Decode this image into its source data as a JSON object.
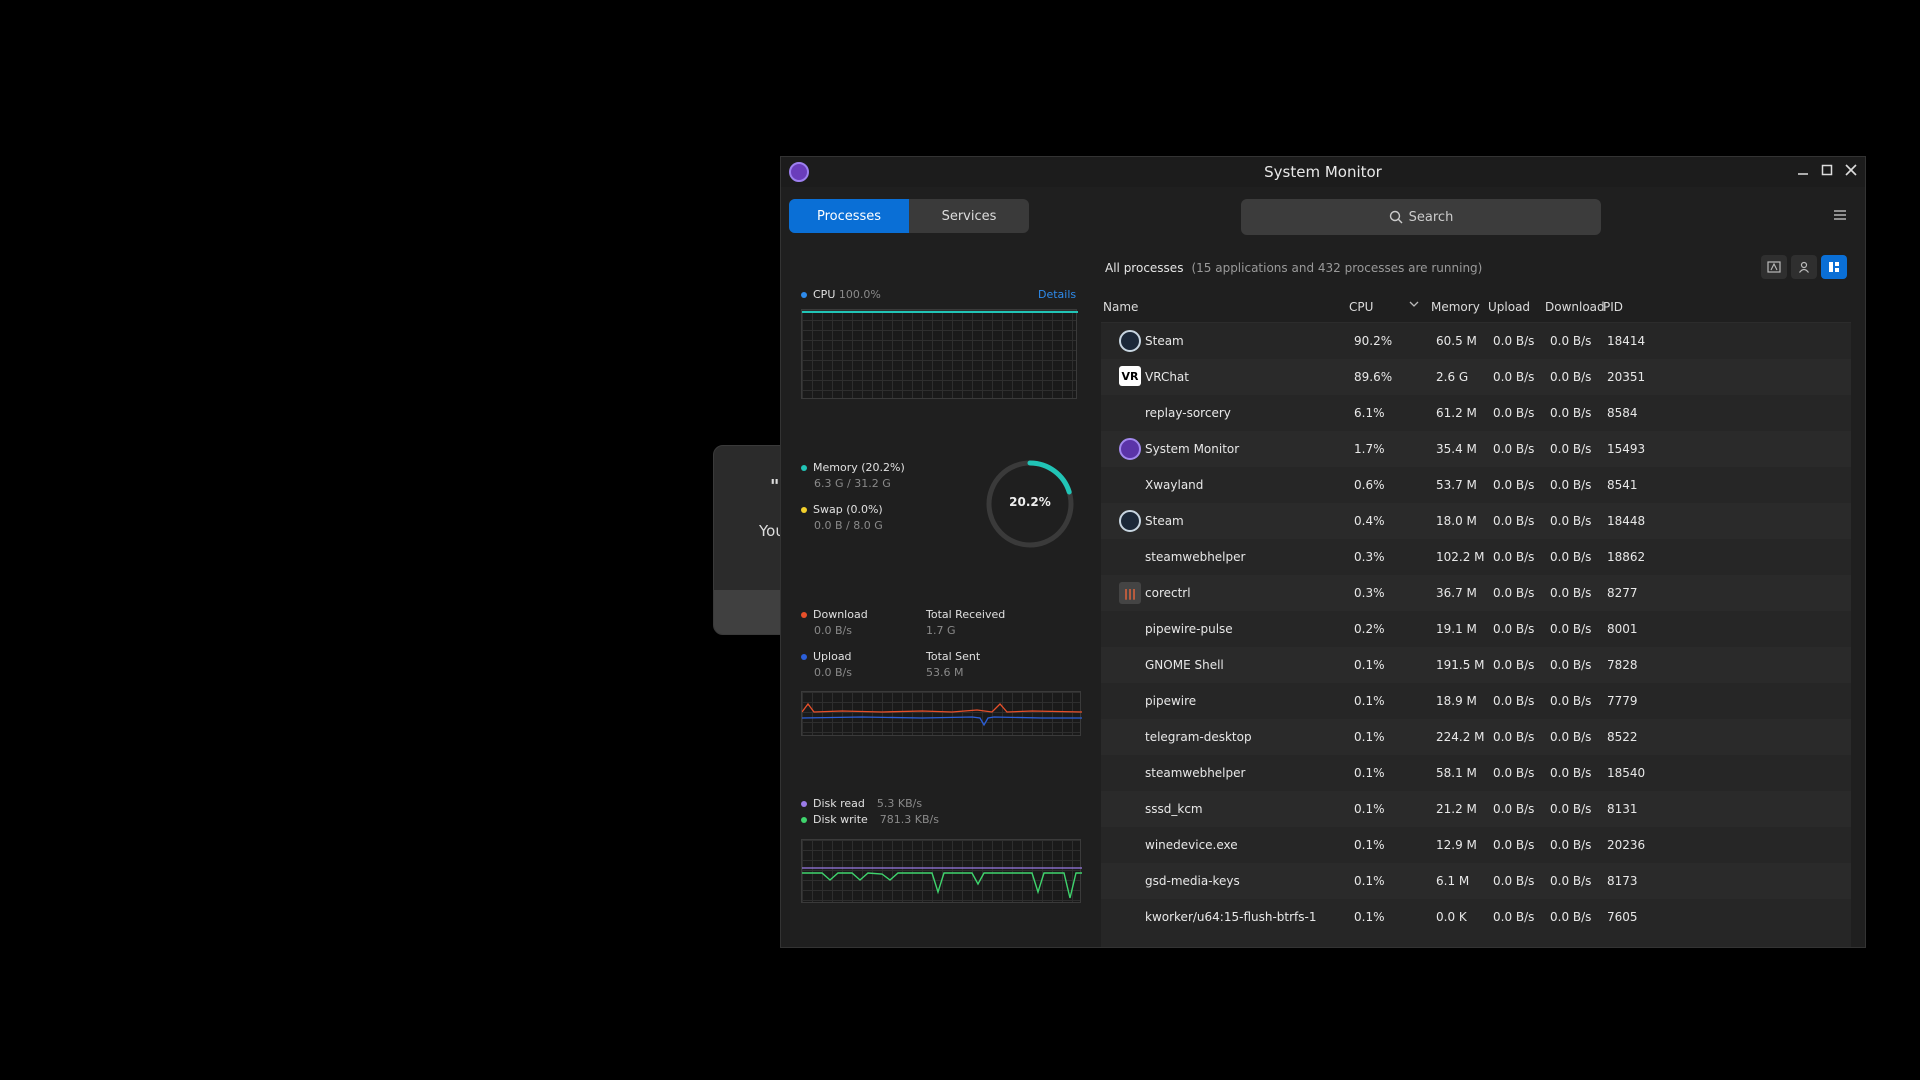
{
  "background_dialog": {
    "quote": "\"",
    "text": "You"
  },
  "window": {
    "title": "System Monitor"
  },
  "tabs": [
    {
      "label": "Processes",
      "active": true
    },
    {
      "label": "Services",
      "active": false
    }
  ],
  "search": {
    "placeholder": "Search"
  },
  "cpu": {
    "label": "CPU",
    "value": "100.0%",
    "details": "Details"
  },
  "memory": {
    "label": "Memory (20.2%)",
    "value": "6.3 G / 31.2 G",
    "ring_label": "20.2%",
    "ring_fraction": 0.202
  },
  "swap": {
    "label": "Swap (0.0%)",
    "value": "0.0 B / 8.0 G"
  },
  "network": {
    "download_label": "Download",
    "download_value": "0.0 B/s",
    "upload_label": "Upload",
    "upload_value": "0.0 B/s",
    "total_received_label": "Total Received",
    "total_received_value": "1.7 G",
    "total_sent_label": "Total Sent",
    "total_sent_value": "53.6 M"
  },
  "disk": {
    "read_label": "Disk read",
    "read_value": "5.3 KB/s",
    "write_label": "Disk write",
    "write_value": "781.3 KB/s"
  },
  "colors": {
    "cpu": "#2e8bec",
    "memory": "#21c4b6",
    "swap": "#f2d02c",
    "download": "#e8502a",
    "upload": "#2b5fd9",
    "disk_read": "#9b7be8",
    "disk_write": "#3fd46d",
    "accent": "#0a6fd6"
  },
  "processes": {
    "heading": "All processes",
    "count_text": "(15 applications and 432 processes are running)",
    "columns": {
      "name": "Name",
      "cpu": "CPU",
      "memory": "Memory",
      "upload": "Upload",
      "download": "Download",
      "pid": "PID"
    },
    "rows": [
      {
        "name": "Steam",
        "cpu": "90.2%",
        "memory": "60.5 M",
        "upload": "0.0 B/s",
        "download": "0.0 B/s",
        "pid": "18414",
        "icon": "steam"
      },
      {
        "name": "VRChat",
        "cpu": "89.6%",
        "memory": "2.6 G",
        "upload": "0.0 B/s",
        "download": "0.0 B/s",
        "pid": "20351",
        "icon": "vr"
      },
      {
        "name": "replay-sorcery",
        "cpu": "6.1%",
        "memory": "61.2 M",
        "upload": "0.0 B/s",
        "download": "0.0 B/s",
        "pid": "8584",
        "icon": ""
      },
      {
        "name": "System Monitor",
        "cpu": "1.7%",
        "memory": "35.4 M",
        "upload": "0.0 B/s",
        "download": "0.0 B/s",
        "pid": "15493",
        "icon": "sysmon"
      },
      {
        "name": "Xwayland",
        "cpu": "0.6%",
        "memory": "53.7 M",
        "upload": "0.0 B/s",
        "download": "0.0 B/s",
        "pid": "8541",
        "icon": ""
      },
      {
        "name": "Steam",
        "cpu": "0.4%",
        "memory": "18.0 M",
        "upload": "0.0 B/s",
        "download": "0.0 B/s",
        "pid": "18448",
        "icon": "steam"
      },
      {
        "name": "steamwebhelper",
        "cpu": "0.3%",
        "memory": "102.2 M",
        "upload": "0.0 B/s",
        "download": "0.0 B/s",
        "pid": "18862",
        "icon": ""
      },
      {
        "name": "corectrl",
        "cpu": "0.3%",
        "memory": "36.7 M",
        "upload": "0.0 B/s",
        "download": "0.0 B/s",
        "pid": "8277",
        "icon": "corectrl"
      },
      {
        "name": "pipewire-pulse",
        "cpu": "0.2%",
        "memory": "19.1 M",
        "upload": "0.0 B/s",
        "download": "0.0 B/s",
        "pid": "8001",
        "icon": ""
      },
      {
        "name": "GNOME Shell",
        "cpu": "0.1%",
        "memory": "191.5 M",
        "upload": "0.0 B/s",
        "download": "0.0 B/s",
        "pid": "7828",
        "icon": ""
      },
      {
        "name": "pipewire",
        "cpu": "0.1%",
        "memory": "18.9 M",
        "upload": "0.0 B/s",
        "download": "0.0 B/s",
        "pid": "7779",
        "icon": ""
      },
      {
        "name": "telegram-desktop",
        "cpu": "0.1%",
        "memory": "224.2 M",
        "upload": "0.0 B/s",
        "download": "0.0 B/s",
        "pid": "8522",
        "icon": ""
      },
      {
        "name": "steamwebhelper",
        "cpu": "0.1%",
        "memory": "58.1 M",
        "upload": "0.0 B/s",
        "download": "0.0 B/s",
        "pid": "18540",
        "icon": ""
      },
      {
        "name": "sssd_kcm",
        "cpu": "0.1%",
        "memory": "21.2 M",
        "upload": "0.0 B/s",
        "download": "0.0 B/s",
        "pid": "8131",
        "icon": ""
      },
      {
        "name": "winedevice.exe",
        "cpu": "0.1%",
        "memory": "12.9 M",
        "upload": "0.0 B/s",
        "download": "0.0 B/s",
        "pid": "20236",
        "icon": ""
      },
      {
        "name": "gsd-media-keys",
        "cpu": "0.1%",
        "memory": "6.1 M",
        "upload": "0.0 B/s",
        "download": "0.0 B/s",
        "pid": "8173",
        "icon": ""
      },
      {
        "name": "kworker/u64:15-flush-btrfs-1",
        "cpu": "0.1%",
        "memory": "0.0 K",
        "upload": "0.0 B/s",
        "download": "0.0 B/s",
        "pid": "7605",
        "icon": ""
      }
    ]
  }
}
